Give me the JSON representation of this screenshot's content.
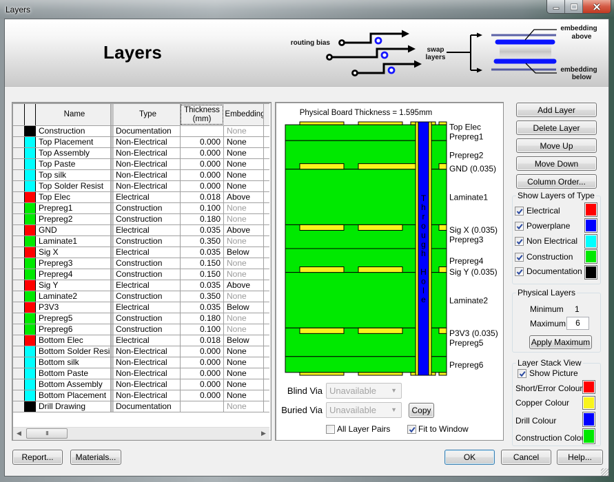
{
  "window": {
    "title": "Layers"
  },
  "icons": {
    "minimize": "minimize-icon",
    "maximize": "maximize-icon",
    "close": "close-icon",
    "dropdown": "chevron-down-icon",
    "check": "checkmark-icon",
    "scroll_left": "arrow-left-icon",
    "scroll_right": "arrow-right-icon"
  },
  "banner": {
    "title": "Layers",
    "diagram": {
      "routing_bias": "routing bias",
      "swap_line1": "swap",
      "swap_line2": "layers",
      "above_line1": "embedding",
      "above_line2": "above",
      "below_line1": "embedding",
      "below_line2": "below"
    }
  },
  "table": {
    "headers": {
      "name": "Name",
      "type": "Type",
      "thickness_line1": "Thickness",
      "thickness_line2": "(mm)",
      "embedding": "Embedding"
    },
    "rows": [
      {
        "name": "Construction",
        "type": "Documentation",
        "thickness": "",
        "embedding": "None",
        "embedding_disabled": true,
        "color": "#000000"
      },
      {
        "name": "Top Placement",
        "type": "Non-Electrical",
        "thickness": "0.000",
        "embedding": "None",
        "embedding_disabled": false,
        "color": "#00ffff"
      },
      {
        "name": "Top Assembly",
        "type": "Non-Electrical",
        "thickness": "0.000",
        "embedding": "None",
        "embedding_disabled": false,
        "color": "#00ffff"
      },
      {
        "name": "Top Paste",
        "type": "Non-Electrical",
        "thickness": "0.000",
        "embedding": "None",
        "embedding_disabled": false,
        "color": "#00ffff"
      },
      {
        "name": "Top silk",
        "type": "Non-Electrical",
        "thickness": "0.000",
        "embedding": "None",
        "embedding_disabled": false,
        "color": "#00ffff"
      },
      {
        "name": "Top Solder Resist",
        "type": "Non-Electrical",
        "thickness": "0.000",
        "embedding": "None",
        "embedding_disabled": false,
        "color": "#00ffff"
      },
      {
        "name": "Top Elec",
        "type": "Electrical",
        "thickness": "0.018",
        "embedding": "Above",
        "embedding_disabled": false,
        "color": "#ff0000"
      },
      {
        "name": "Prepreg1",
        "type": "Construction",
        "thickness": "0.100",
        "embedding": "None",
        "embedding_disabled": true,
        "color": "#00e900"
      },
      {
        "name": "Prepreg2",
        "type": "Construction",
        "thickness": "0.180",
        "embedding": "None",
        "embedding_disabled": true,
        "color": "#00e900"
      },
      {
        "name": "GND",
        "type": "Electrical",
        "thickness": "0.035",
        "embedding": "Above",
        "embedding_disabled": false,
        "color": "#ff0000"
      },
      {
        "name": "Laminate1",
        "type": "Construction",
        "thickness": "0.350",
        "embedding": "None",
        "embedding_disabled": true,
        "color": "#00e900"
      },
      {
        "name": "Sig X",
        "type": "Electrical",
        "thickness": "0.035",
        "embedding": "Below",
        "embedding_disabled": false,
        "color": "#ff0000"
      },
      {
        "name": "Prepreg3",
        "type": "Construction",
        "thickness": "0.150",
        "embedding": "None",
        "embedding_disabled": true,
        "color": "#00e900"
      },
      {
        "name": "Prepreg4",
        "type": "Construction",
        "thickness": "0.150",
        "embedding": "None",
        "embedding_disabled": true,
        "color": "#00e900"
      },
      {
        "name": "Sig Y",
        "type": "Electrical",
        "thickness": "0.035",
        "embedding": "Above",
        "embedding_disabled": false,
        "color": "#ff0000"
      },
      {
        "name": "Laminate2",
        "type": "Construction",
        "thickness": "0.350",
        "embedding": "None",
        "embedding_disabled": true,
        "color": "#00e900"
      },
      {
        "name": "P3V3",
        "type": "Electrical",
        "thickness": "0.035",
        "embedding": "Below",
        "embedding_disabled": false,
        "color": "#ff0000"
      },
      {
        "name": "Prepreg5",
        "type": "Construction",
        "thickness": "0.180",
        "embedding": "None",
        "embedding_disabled": true,
        "color": "#00e900"
      },
      {
        "name": "Prepreg6",
        "type": "Construction",
        "thickness": "0.100",
        "embedding": "None",
        "embedding_disabled": true,
        "color": "#00e900"
      },
      {
        "name": "Bottom Elec",
        "type": "Electrical",
        "thickness": "0.018",
        "embedding": "Below",
        "embedding_disabled": false,
        "color": "#ff0000"
      },
      {
        "name": "Bottom Solder Resist",
        "type": "Non-Electrical",
        "thickness": "0.000",
        "embedding": "None",
        "embedding_disabled": false,
        "color": "#00ffff"
      },
      {
        "name": "Bottom silk",
        "type": "Non-Electrical",
        "thickness": "0.000",
        "embedding": "None",
        "embedding_disabled": false,
        "color": "#00ffff"
      },
      {
        "name": "Bottom Paste",
        "type": "Non-Electrical",
        "thickness": "0.000",
        "embedding": "None",
        "embedding_disabled": false,
        "color": "#00ffff"
      },
      {
        "name": "Bottom Assembly",
        "type": "Non-Electrical",
        "thickness": "0.000",
        "embedding": "None",
        "embedding_disabled": false,
        "color": "#00ffff"
      },
      {
        "name": "Bottom Placement",
        "type": "Non-Electrical",
        "thickness": "0.000",
        "embedding": "None",
        "embedding_disabled": false,
        "color": "#00ffff"
      },
      {
        "name": "Drill Drawing",
        "type": "Documentation",
        "thickness": "",
        "embedding": "None",
        "embedding_disabled": true,
        "color": "#000000"
      }
    ],
    "scrollbar_grip": "III"
  },
  "stack_view": {
    "title": "Physical Board Thickness = 1.595mm",
    "board_thickness_mm": 1.595,
    "drill_label": "Through Hole",
    "drill_connected_layers": [
      "GND"
    ],
    "labels": [
      {
        "layer": "Top Elec",
        "text": "Top Elec"
      },
      {
        "layer": "Prepreg1",
        "text": "Prepreg1"
      },
      {
        "layer": "Prepreg2",
        "text": "Prepreg2"
      },
      {
        "layer": "GND",
        "text": "GND (0.035)"
      },
      {
        "layer": "Laminate1",
        "text": "Laminate1"
      },
      {
        "layer": "Sig X",
        "text": "Sig X (0.035)"
      },
      {
        "layer": "Prepreg3",
        "text": "Prepreg3"
      },
      {
        "layer": "Prepreg4",
        "text": "Prepreg4"
      },
      {
        "layer": "Sig Y",
        "text": "Sig Y (0.035)"
      },
      {
        "layer": "Laminate2",
        "text": "Laminate2"
      },
      {
        "layer": "P3V3",
        "text": "P3V3 (0.035)"
      },
      {
        "layer": "Prepreg5",
        "text": "Prepreg5"
      },
      {
        "layer": "Prepreg6",
        "text": "Prepreg6"
      }
    ],
    "blind_via": {
      "label": "Blind Via",
      "value": "Unavailable",
      "disabled": true
    },
    "buried_via": {
      "label": "Buried Via",
      "value": "Unavailable",
      "disabled": true
    },
    "copy_label": "Copy",
    "all_layer_pairs": {
      "label": "All Layer Pairs",
      "checked": false
    },
    "fit_to_window": {
      "label": "Fit to Window",
      "checked": true
    }
  },
  "side_buttons": [
    {
      "label": "Add Layer"
    },
    {
      "label": "Delete Layer"
    },
    {
      "label": "Move Up"
    },
    {
      "label": "Move Down"
    },
    {
      "label": "Column Order..."
    }
  ],
  "show_layers_of_type": {
    "title": "Show Layers of Type",
    "items": [
      {
        "label": "Electrical",
        "checked": true,
        "color": "#ff0000"
      },
      {
        "label": "Powerplane",
        "checked": true,
        "color": "#0000ff"
      },
      {
        "label": "Non Electrical",
        "checked": true,
        "color": "#00ffff"
      },
      {
        "label": "Construction",
        "checked": true,
        "color": "#00e900"
      },
      {
        "label": "Documentation",
        "checked": true,
        "color": "#000000"
      }
    ]
  },
  "physical_layers": {
    "title": "Physical Layers",
    "minimum_label": "Minimum",
    "minimum_value": "1",
    "maximum_label": "Maximum",
    "maximum_value": "6",
    "apply_label": "Apply Maximum"
  },
  "layer_stack_view": {
    "title": "Layer Stack View",
    "show_picture_label": "Show Picture",
    "show_picture_checked": true,
    "colours": [
      {
        "label": "Short/Error Colour",
        "color": "#ff0000"
      },
      {
        "label": "Copper Colour",
        "color": "#f8f41c"
      },
      {
        "label": "Drill Colour",
        "color": "#0000ff"
      },
      {
        "label": "Construction Colour",
        "color": "#00e900"
      }
    ]
  },
  "footer": {
    "report_label": "Report...",
    "materials_label": "Materials...",
    "ok_label": "OK",
    "cancel_label": "Cancel",
    "help_label": "Help..."
  }
}
